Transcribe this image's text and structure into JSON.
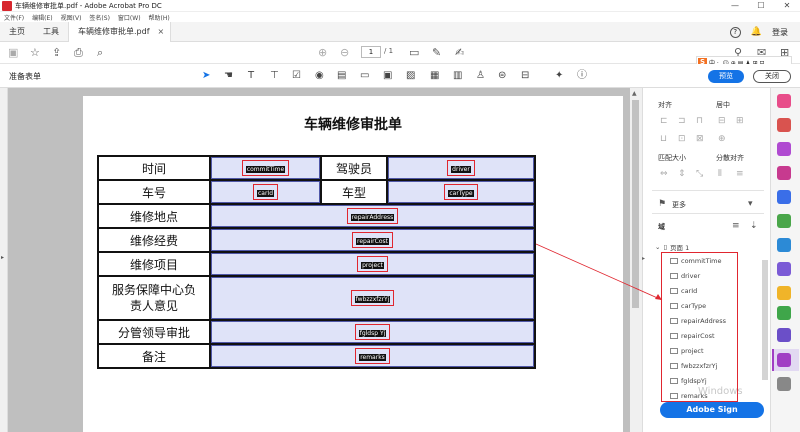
{
  "window": {
    "title": "车辆维修审批单.pdf - Adobe Acrobat Pro DC",
    "minimize": "—",
    "maximize": "☐",
    "close": "✕"
  },
  "menu": [
    "文件(F)",
    "编辑(E)",
    "视图(V)",
    "签名(S)",
    "窗口(W)",
    "帮助(H)"
  ],
  "tabs": {
    "home": "主页",
    "tools": "工具",
    "document": "车辆维修审批单.pdf",
    "close": "×",
    "help": "?",
    "bell": "🔔",
    "login": "登录"
  },
  "toolbar": {
    "page_current": "1",
    "page_total": "/ 1"
  },
  "formbar": {
    "label": "准备表单",
    "preview": "预览",
    "close": "关闭"
  },
  "ime": {
    "logo": "S",
    "text": "中 ·, ☺ ⊕ ▤ ♟ ⊞ ⊟"
  },
  "document": {
    "title": "车辆维修审批单",
    "rows": [
      {
        "type": "pair",
        "label1": "时间",
        "field1": "commitTime",
        "label2": "驾驶员",
        "field2": "driver"
      },
      {
        "type": "pair",
        "label1": "车号",
        "field1": "carId",
        "label2": "车型",
        "field2": "carType"
      },
      {
        "type": "single",
        "label": "维修地点",
        "field": "repairAddress"
      },
      {
        "type": "single",
        "label": "维修经费",
        "field": "repairCost"
      },
      {
        "type": "single",
        "label": "维修项目",
        "field": "project"
      },
      {
        "type": "tall",
        "label": "服务保障中心负责人意见",
        "field": "fwbzzxfzrYj"
      },
      {
        "type": "single",
        "label": "分管领导审批",
        "field": "fgldsp Yj"
      },
      {
        "type": "single",
        "label": "备注",
        "field": "remarks"
      }
    ]
  },
  "right_panel": {
    "align": "对齐",
    "center": "居中",
    "match_size": "匹配大小",
    "distribute": "分散对齐",
    "more": "更多",
    "fields_heading": "域",
    "page_node": "页面 1",
    "fields": [
      "commitTime",
      "driver",
      "carId",
      "carType",
      "repairAddress",
      "repairCost",
      "project",
      "fwbzzxfzrYj",
      "fgldspYj",
      "remarks"
    ],
    "adobe_sign": "Adobe Sign",
    "watermark": "Windows"
  },
  "colors": {
    "accent": "#1473e6",
    "field_fill": "#dfe3f8",
    "highlight": "#e0262f",
    "tool_purple": "#a13fc4"
  }
}
